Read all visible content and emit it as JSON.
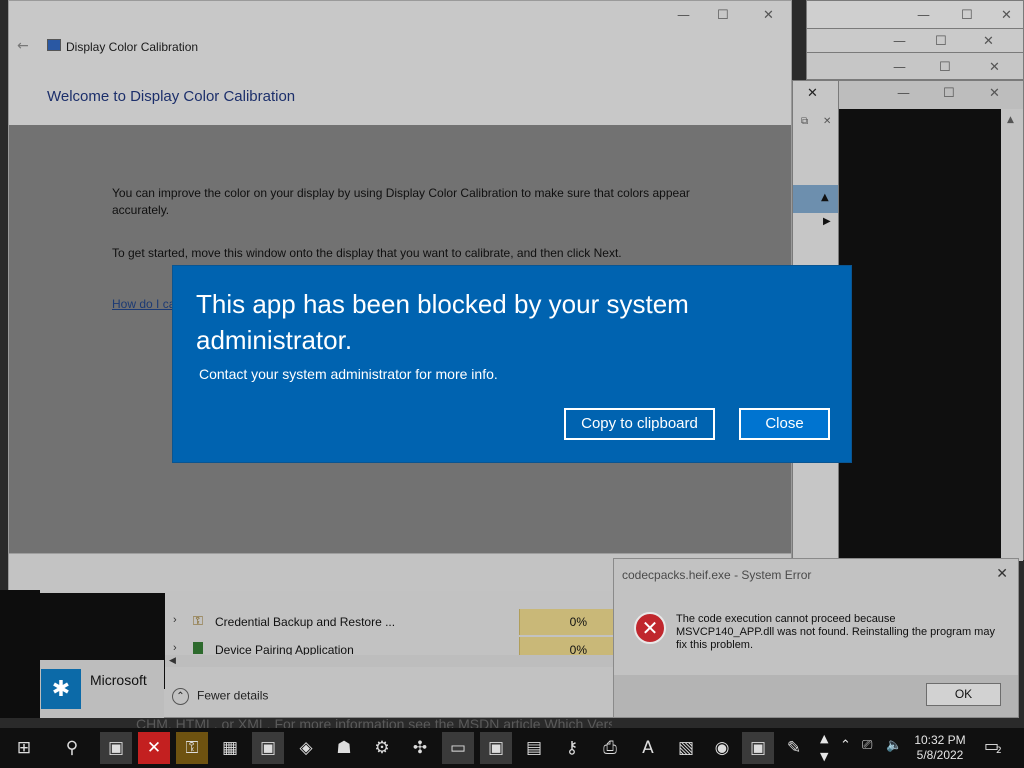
{
  "calibration": {
    "title": "Display Color Calibration",
    "welcome": "Welcome to Display Color Calibration",
    "para1": "You can improve the color on your display by using Display Color Calibration to make sure that colors appear accurately.",
    "para2": "To get started, move this window onto the display that you want to calibrate, and then click Next.",
    "link": "How do I calibrate my display?"
  },
  "blocked_dialog": {
    "heading": "This app has been blocked by your system administrator.",
    "subtext": "Contact your system administrator for more info.",
    "copy_label": "Copy to clipboard",
    "close_label": "Close",
    "color": "#0063b0"
  },
  "task_manager": {
    "rows": [
      {
        "name": "Credential Backup and Restore ...",
        "cpu": "0%"
      },
      {
        "name": "Device Pairing Application",
        "cpu": "0%"
      }
    ],
    "fewer_details": "Fewer details"
  },
  "ms_tile": {
    "name": "Microsoft"
  },
  "bottom_text": "CHM, HTML, or XML. For more information see the MSDN article Which Version of Help do I",
  "system_error": {
    "title": "codecpacks.heif.exe - System Error",
    "message": "The code execution cannot proceed because MSVCP140_APP.dll was not found. Reinstalling the program may fix this problem.",
    "ok_label": "OK"
  },
  "taskbar": {
    "time": "10:32 PM",
    "date": "5/8/2022",
    "notification_count": "2"
  }
}
